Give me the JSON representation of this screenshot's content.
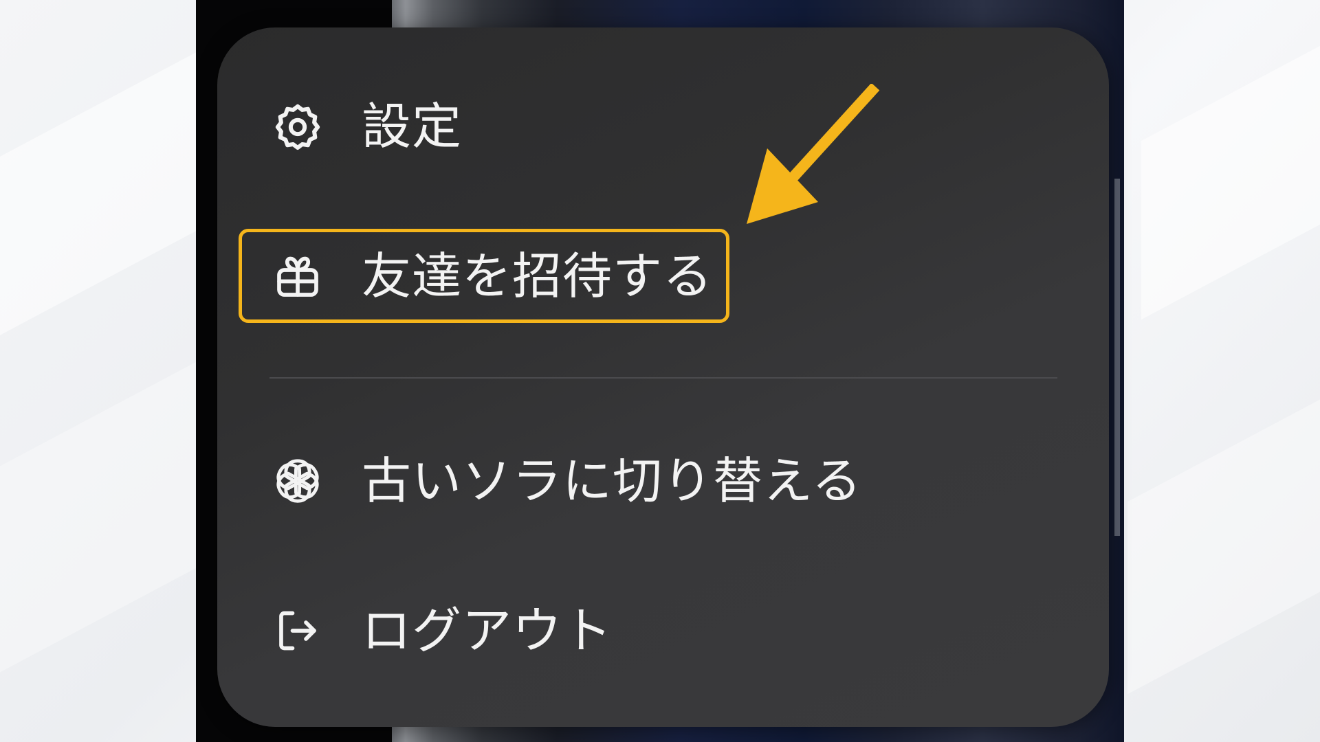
{
  "menu": {
    "items": [
      {
        "label": "設定",
        "icon": "gear-icon"
      },
      {
        "label": "友達を招待する",
        "icon": "gift-icon"
      },
      {
        "label": "古いソラに切り替える",
        "icon": "openai-logo-icon"
      },
      {
        "label": "ログアウト",
        "icon": "logout-icon"
      }
    ]
  },
  "annotation": {
    "highlight_color": "#f5b51b",
    "arrow_color": "#f5b51b",
    "highlighted_item": "友達を招待する"
  }
}
